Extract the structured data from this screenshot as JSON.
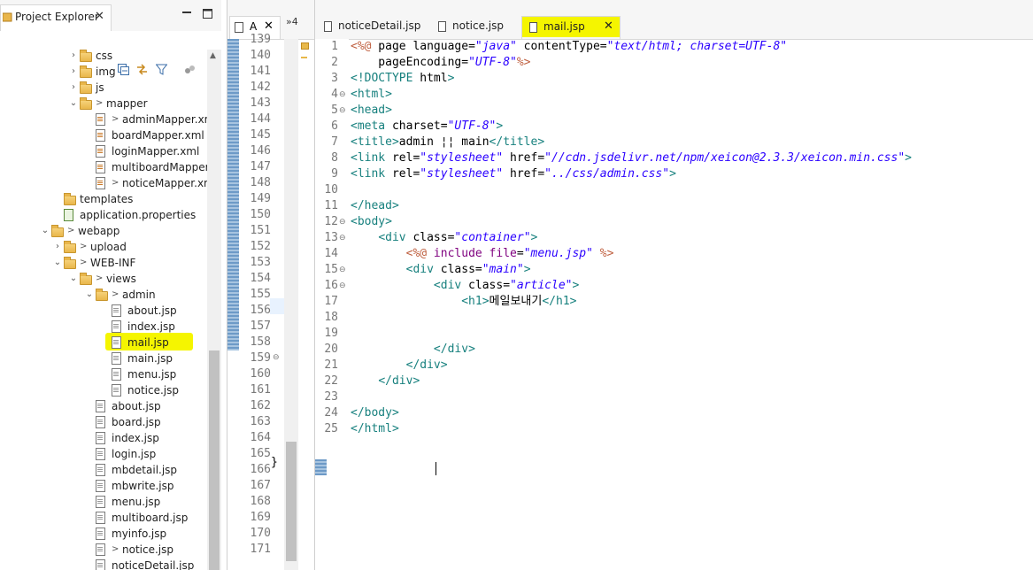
{
  "explorer": {
    "title": "Project Explorer",
    "close_glyph": "✕",
    "minimize_glyph": "▬",
    "maximize_glyph": "☐",
    "toolbar_icons": [
      "collapse-all-icon",
      "link-editor-icon",
      "filter-icon",
      "java-toggle-icon",
      "view-menu-icon"
    ],
    "tree": [
      {
        "label": "css",
        "kind": "folder",
        "twisty": "›"
      },
      {
        "label": "img",
        "kind": "folder",
        "twisty": "›"
      },
      {
        "label": "js",
        "kind": "folder",
        "twisty": "›"
      },
      {
        "label": "mapper",
        "kind": "folder",
        "twisty": "⌄",
        "dec": ">"
      },
      {
        "label": "adminMapper.xm",
        "kind": "xml",
        "dec": ">"
      },
      {
        "label": "boardMapper.xml",
        "kind": "xml"
      },
      {
        "label": "loginMapper.xml",
        "kind": "xml"
      },
      {
        "label": "multiboardMapper.:",
        "kind": "xml"
      },
      {
        "label": "noticeMapper.xm",
        "kind": "xml",
        "dec": ">"
      },
      {
        "label": "templates",
        "kind": "folder"
      },
      {
        "label": "application.properties",
        "kind": "props"
      },
      {
        "label": "webapp",
        "kind": "folder",
        "twisty": "⌄",
        "dec": ">"
      },
      {
        "label": "upload",
        "kind": "folder",
        "twisty": "›",
        "dec": ">"
      },
      {
        "label": "WEB-INF",
        "kind": "folder",
        "twisty": "⌄",
        "dec": ">"
      },
      {
        "label": "views",
        "kind": "folder",
        "twisty": "⌄",
        "dec": ">"
      },
      {
        "label": "admin",
        "kind": "folder",
        "twisty": "⌄",
        "dec": ">"
      },
      {
        "label": "about.jsp",
        "kind": "file"
      },
      {
        "label": "index.jsp",
        "kind": "file"
      },
      {
        "label": "mail.jsp",
        "kind": "file"
      },
      {
        "label": "main.jsp",
        "kind": "file"
      },
      {
        "label": "menu.jsp",
        "kind": "file"
      },
      {
        "label": "notice.jsp",
        "kind": "file"
      },
      {
        "label": "about.jsp",
        "kind": "file"
      },
      {
        "label": "board.jsp",
        "kind": "file"
      },
      {
        "label": "index.jsp",
        "kind": "file"
      },
      {
        "label": "login.jsp",
        "kind": "file"
      },
      {
        "label": "mbdetail.jsp",
        "kind": "file"
      },
      {
        "label": "mbwrite.jsp",
        "kind": "file"
      },
      {
        "label": "menu.jsp",
        "kind": "file"
      },
      {
        "label": "multiboard.jsp",
        "kind": "file"
      },
      {
        "label": "myinfo.jsp",
        "kind": "file"
      },
      {
        "label": "notice.jsp",
        "kind": "file",
        "dec": ">"
      },
      {
        "label": "noticeDetail.jsp",
        "kind": "file"
      }
    ]
  },
  "editor_a": {
    "tab_label": "A",
    "close_glyph": "✕",
    "more_tabs": "»4",
    "line_numbers": [
      "139",
      "140",
      "141",
      "142",
      "143",
      "144",
      "145",
      "146",
      "147",
      "148",
      "149",
      "150",
      "151",
      "152",
      "153",
      "154",
      "155",
      "156",
      "157",
      "158",
      "159",
      "160",
      "161",
      "162",
      "163",
      "164",
      "165",
      "166",
      "167",
      "168",
      "169",
      "170",
      "171"
    ],
    "brace": "}"
  },
  "editor": {
    "tabs": [
      {
        "label": "noticeDetail.jsp",
        "active": false
      },
      {
        "label": "notice.jsp",
        "active": false
      },
      {
        "label": "mail.jsp",
        "active": true,
        "close_glyph": "✕"
      }
    ],
    "line_numbers": [
      "1",
      "2",
      "3",
      "4",
      "5",
      "6",
      "7",
      "8",
      "9",
      "10",
      "11",
      "12",
      "13",
      "14",
      "15",
      "16",
      "17",
      "18",
      "19",
      "20",
      "21",
      "22",
      "23",
      "24",
      "25"
    ],
    "fold_glyph": "⊖",
    "code_lines": [
      "<%@ page language=\"java\" contentType=\"text/html; charset=UTF-8\"",
      "    pageEncoding=\"UTF-8\"%>",
      "<!DOCTYPE html>",
      "<html>",
      "<head>",
      "<meta charset=\"UTF-8\">",
      "<title>admin ¦¦ main</title>",
      "<link rel=\"stylesheet\" href=\"//cdn.jsdelivr.net/npm/xeicon@2.3.3/xeicon.min.css\">",
      "<link rel=\"stylesheet\" href=\"../css/admin.css\">",
      "",
      "</head>",
      "<body>",
      "    <div class=\"container\">",
      "        <%@ include file=\"menu.jsp\" %>",
      "        <div class=\"main\">",
      "            <div class=\"article\">",
      "                <h1>메일보내기</h1>",
      "",
      "",
      "            </div>",
      "        </div>",
      "    </div>",
      "",
      "</body>",
      "</html>"
    ]
  }
}
